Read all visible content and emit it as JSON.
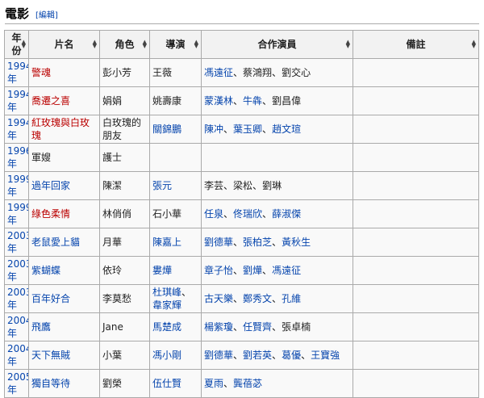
{
  "section": {
    "title": "電影",
    "edit_label": "編輯"
  },
  "columns": [
    {
      "label": "年份",
      "sortable": true
    },
    {
      "label": "片名",
      "sortable": true
    },
    {
      "label": "角色",
      "sortable": true
    },
    {
      "label": "導演",
      "sortable": true
    },
    {
      "label": "合作演員",
      "sortable": true
    },
    {
      "label": "備註",
      "sortable": true
    }
  ],
  "rows": [
    {
      "year": "1994年",
      "title": {
        "text": "警魂",
        "link": "red"
      },
      "role": "彭小芳",
      "director": [
        {
          "text": "王薇",
          "link": "none"
        }
      ],
      "costars": [
        {
          "text": "馮遠征",
          "link": "blue"
        },
        {
          "text": "蔡鴻翔",
          "link": "none"
        },
        {
          "text": "劉交心",
          "link": "none"
        }
      ],
      "note": ""
    },
    {
      "year": "1994年",
      "title": {
        "text": "喬遷之喜",
        "link": "red"
      },
      "role": "娟娟",
      "director": [
        {
          "text": "姚壽康",
          "link": "none"
        }
      ],
      "costars": [
        {
          "text": "蒙漢林",
          "link": "blue"
        },
        {
          "text": "牛犇",
          "link": "blue"
        },
        {
          "text": "劉昌偉",
          "link": "none"
        }
      ],
      "note": ""
    },
    {
      "year": "1994年",
      "title": {
        "text": "紅玫瑰與白玫瑰",
        "link": "red"
      },
      "role": "白玫瑰的朋友",
      "director": [
        {
          "text": "關錦鵬",
          "link": "blue"
        }
      ],
      "costars": [
        {
          "text": "陳冲",
          "link": "blue"
        },
        {
          "text": "葉玉卿",
          "link": "blue"
        },
        {
          "text": "趙文瑄",
          "link": "blue"
        }
      ],
      "note": ""
    },
    {
      "year": "1996年",
      "title": {
        "text": "軍嫂",
        "link": "none"
      },
      "role": "護士",
      "director": [],
      "costars": [],
      "note": ""
    },
    {
      "year": "1999年",
      "title": {
        "text": "過年回家",
        "link": "blue"
      },
      "role": "陳潔",
      "director": [
        {
          "text": "張元",
          "link": "blue"
        }
      ],
      "costars": [
        {
          "text": "李芸",
          "link": "none"
        },
        {
          "text": "梁松",
          "link": "none"
        },
        {
          "text": "劉琳",
          "link": "none"
        }
      ],
      "note": ""
    },
    {
      "year": "1999年",
      "title": {
        "text": "綠色柔情",
        "link": "red"
      },
      "role": "林俏俏",
      "director": [
        {
          "text": "石小華",
          "link": "none"
        }
      ],
      "costars": [
        {
          "text": "任泉",
          "link": "blue"
        },
        {
          "text": "佟瑞欣",
          "link": "blue"
        },
        {
          "text": "薛淑傑",
          "link": "blue"
        }
      ],
      "note": ""
    },
    {
      "year": "2003年",
      "title": {
        "text": "老鼠愛上貓",
        "link": "blue"
      },
      "role": "月華",
      "director": [
        {
          "text": "陳嘉上",
          "link": "blue"
        }
      ],
      "costars": [
        {
          "text": "劉德華",
          "link": "blue"
        },
        {
          "text": "張柏芝",
          "link": "blue"
        },
        {
          "text": "黃秋生",
          "link": "blue"
        }
      ],
      "note": ""
    },
    {
      "year": "2003年",
      "title": {
        "text": "紫蝴蝶",
        "link": "blue"
      },
      "role": "依玲",
      "director": [
        {
          "text": "婁燁",
          "link": "blue"
        }
      ],
      "costars": [
        {
          "text": "章子怡",
          "link": "blue"
        },
        {
          "text": "劉燁",
          "link": "blue"
        },
        {
          "text": "馮遠征",
          "link": "blue"
        }
      ],
      "note": ""
    },
    {
      "year": "2003年",
      "title": {
        "text": "百年好合",
        "link": "blue"
      },
      "role": "李莫愁",
      "director": [
        {
          "text": "杜琪峰",
          "link": "blue"
        },
        {
          "text": "韋家輝",
          "link": "blue"
        }
      ],
      "costars": [
        {
          "text": "古天樂",
          "link": "blue"
        },
        {
          "text": "鄭秀文",
          "link": "blue"
        },
        {
          "text": "孔維",
          "link": "blue"
        }
      ],
      "note": ""
    },
    {
      "year": "2004年",
      "title": {
        "text": "飛鷹",
        "link": "blue"
      },
      "role": "Jane",
      "director": [
        {
          "text": "馬楚成",
          "link": "blue"
        }
      ],
      "costars": [
        {
          "text": "楊紫瓊",
          "link": "blue"
        },
        {
          "text": "任賢齊",
          "link": "blue"
        },
        {
          "text": "張卓楠",
          "link": "none"
        }
      ],
      "note": ""
    },
    {
      "year": "2004年",
      "title": {
        "text": "天下無賊",
        "link": "blue"
      },
      "role": "小葉",
      "director": [
        {
          "text": "馮小剛",
          "link": "blue"
        }
      ],
      "costars": [
        {
          "text": "劉德華",
          "link": "blue"
        },
        {
          "text": "劉若英",
          "link": "blue"
        },
        {
          "text": "葛優",
          "link": "blue"
        },
        {
          "text": "王寶強",
          "link": "blue"
        }
      ],
      "note": ""
    },
    {
      "year": "2005年",
      "title": {
        "text": "獨自等待",
        "link": "blue"
      },
      "role": "劉榮",
      "director": [
        {
          "text": "伍仕賢",
          "link": "blue"
        }
      ],
      "costars": [
        {
          "text": "夏雨",
          "link": "blue"
        },
        {
          "text": "龔蓓苾",
          "link": "blue"
        }
      ],
      "note": ""
    }
  ],
  "separator": "、",
  "colors": {
    "link_blue": "#0645ad",
    "link_red": "#ba0000",
    "header_bg": "#f2f2f2",
    "cell_bg": "#f9f9f9",
    "border": "#aaaaaa"
  }
}
